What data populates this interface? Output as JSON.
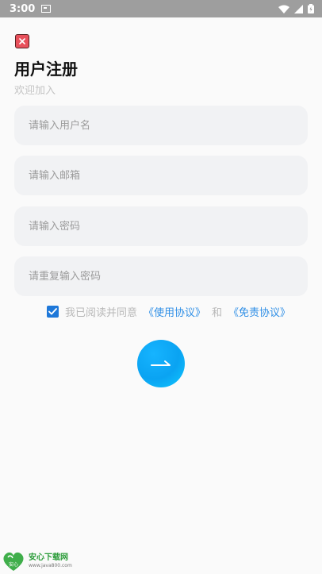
{
  "status_bar": {
    "time": "3:00"
  },
  "header": {
    "title": "用户注册",
    "subtitle": "欢迎加入"
  },
  "form": {
    "username_placeholder": "请输入用户名",
    "email_placeholder": "请输入邮箱",
    "password_placeholder": "请输入密码",
    "confirm_password_placeholder": "请重复输入密码"
  },
  "agreement": {
    "checked": true,
    "text": "我已阅读并同意",
    "terms_link": "《使用协议》",
    "and": "和",
    "disclaimer_link": "《免责协议》"
  },
  "watermark": {
    "logo_text": "安心",
    "title": "安心下载网",
    "url": "www.java800.com"
  },
  "colors": {
    "accent": "#0aa3f2",
    "link": "#2f8fe6",
    "close": "#e8505b",
    "field_bg": "#f1f2f4"
  }
}
